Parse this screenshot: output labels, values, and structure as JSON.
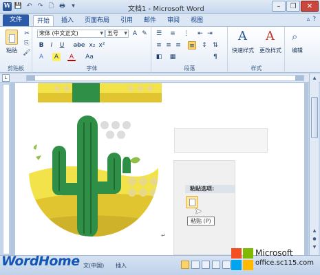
{
  "window": {
    "title": "文档1 - Microsoft Word"
  },
  "qat": [
    "W",
    "💾",
    "↶",
    "↷",
    "🗋",
    "🖶",
    "▾"
  ],
  "window_controls": [
    "–",
    "❐",
    "✕"
  ],
  "tabs": {
    "file": "文件",
    "items": [
      "开始",
      "插入",
      "页面布局",
      "引用",
      "邮件",
      "审阅",
      "视图"
    ],
    "active": "开始"
  },
  "ribbon": {
    "clipboard": {
      "label": "剪贴板",
      "paste": "粘贴"
    },
    "font": {
      "label": "字体",
      "font_name": "宋体 (中文正文)",
      "font_size": "五号",
      "buttons": [
        "B",
        "I",
        "U",
        "abe",
        "x₂",
        "x²",
        "A",
        "A",
        "A",
        "Aa"
      ]
    },
    "paragraph": {
      "label": "段落"
    },
    "styles": {
      "label": "样式",
      "quick": "快速样式",
      "change": "更改样式"
    },
    "editing": {
      "label": "编辑"
    }
  },
  "paste_options": {
    "header": "粘贴选项:",
    "tooltip": "粘贴 (P)"
  },
  "statusbar": {
    "language": "文(中国)",
    "mode": "插入"
  },
  "watermark": {
    "left": "WordHome",
    "brand": "Microsoft",
    "url": "office.sc115.com"
  },
  "colors": {
    "accent": "#2a5aa8",
    "cactus": "#2f8f47",
    "sand": "#e0c531"
  }
}
